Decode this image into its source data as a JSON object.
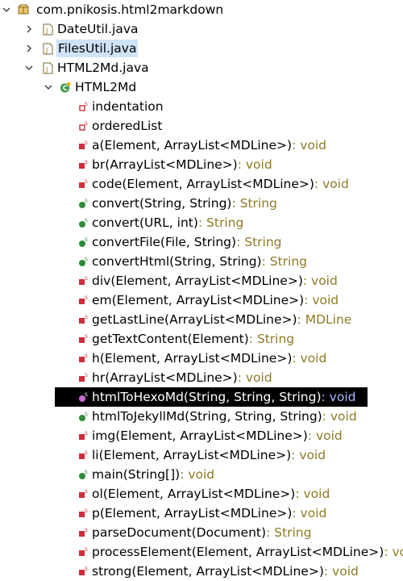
{
  "tree": {
    "package": {
      "label": "com.pnikosis.html2markdown"
    },
    "files": [
      {
        "label": "DateUtil.java"
      },
      {
        "label": "FilesUtil.java"
      },
      {
        "label": "HTML2Md.java"
      }
    ],
    "class": {
      "label": "HTML2Md"
    },
    "members": [
      {
        "name": "indentation",
        "ret": ""
      },
      {
        "name": "orderedList",
        "ret": ""
      },
      {
        "name": "a(Element, ArrayList<MDLine>)",
        "ret": " : void"
      },
      {
        "name": "br(ArrayList<MDLine>)",
        "ret": " : void"
      },
      {
        "name": "code(Element, ArrayList<MDLine>)",
        "ret": " : void"
      },
      {
        "name": "convert(String, String)",
        "ret": " : String"
      },
      {
        "name": "convert(URL, int)",
        "ret": " : String"
      },
      {
        "name": "convertFile(File, String)",
        "ret": " : String"
      },
      {
        "name": "convertHtml(String, String)",
        "ret": " : String"
      },
      {
        "name": "div(Element, ArrayList<MDLine>)",
        "ret": " : void"
      },
      {
        "name": "em(Element, ArrayList<MDLine>)",
        "ret": " : void"
      },
      {
        "name": "getLastLine(ArrayList<MDLine>)",
        "ret": " : MDLine"
      },
      {
        "name": "getTextContent(Element)",
        "ret": " : String"
      },
      {
        "name": "h(Element, ArrayList<MDLine>)",
        "ret": " : void"
      },
      {
        "name": "hr(ArrayList<MDLine>)",
        "ret": " : void"
      },
      {
        "name": "htmlToHexoMd(String, String, String)",
        "ret": " : void"
      },
      {
        "name": "htmlToJekyllMd(String, String, String)",
        "ret": " : void"
      },
      {
        "name": "img(Element, ArrayList<MDLine>)",
        "ret": " : void"
      },
      {
        "name": "li(Element, ArrayList<MDLine>)",
        "ret": " : void"
      },
      {
        "name": "main(String[])",
        "ret": " : void"
      },
      {
        "name": "ol(Element, ArrayList<MDLine>)",
        "ret": " : void"
      },
      {
        "name": "p(Element, ArrayList<MDLine>)",
        "ret": " : void"
      },
      {
        "name": "parseDocument(Document)",
        "ret": " : String"
      },
      {
        "name": "processElement(Element, ArrayList<MDLine>)",
        "ret": " : voi"
      },
      {
        "name": "strong(Element, ArrayList<MDLine>)",
        "ret": " : void"
      }
    ]
  },
  "colors": {
    "selection_bg": "#000000",
    "return_type": "#8f7a26",
    "private_method": "#d12c3b",
    "public_method": "#2e8b3a",
    "field": "#d12c3b"
  }
}
